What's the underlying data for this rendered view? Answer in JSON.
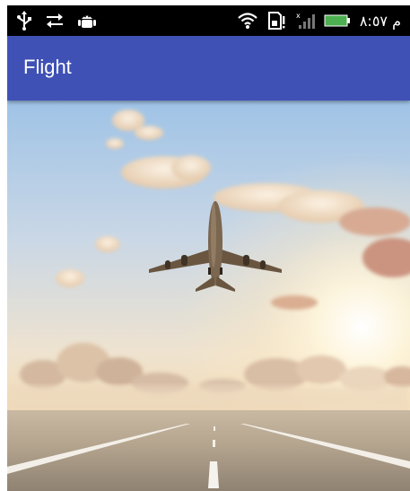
{
  "status_bar": {
    "time": "م ٨:٥٧",
    "icons": [
      "usb-icon",
      "sync-icon",
      "android-debug-icon",
      "wifi-icon",
      "sd-card-icon",
      "signal-icon",
      "battery-icon"
    ]
  },
  "app_bar": {
    "title": "Flight",
    "color": "#3f51b5"
  },
  "hero": {
    "description_icon": "airplane-takeoff-image"
  },
  "colors": {
    "status_bar": "#000000",
    "accent": "#3f51b5",
    "title_text": "#ffffff"
  }
}
